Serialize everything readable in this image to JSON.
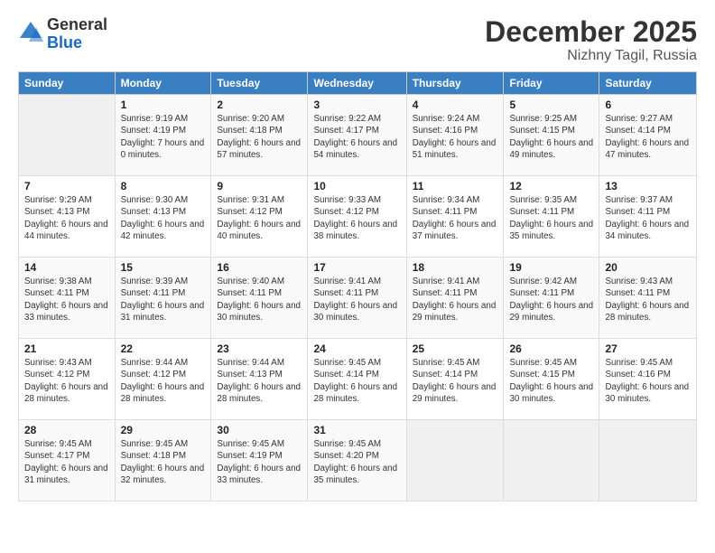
{
  "logo": {
    "general": "General",
    "blue": "Blue"
  },
  "title": {
    "month": "December 2025",
    "location": "Nizhny Tagil, Russia"
  },
  "days_of_week": [
    "Sunday",
    "Monday",
    "Tuesday",
    "Wednesday",
    "Thursday",
    "Friday",
    "Saturday"
  ],
  "weeks": [
    [
      {
        "day": "",
        "info": ""
      },
      {
        "day": "1",
        "info": "Sunrise: 9:19 AM\nSunset: 4:19 PM\nDaylight: 7 hours\nand 0 minutes."
      },
      {
        "day": "2",
        "info": "Sunrise: 9:20 AM\nSunset: 4:18 PM\nDaylight: 6 hours\nand 57 minutes."
      },
      {
        "day": "3",
        "info": "Sunrise: 9:22 AM\nSunset: 4:17 PM\nDaylight: 6 hours\nand 54 minutes."
      },
      {
        "day": "4",
        "info": "Sunrise: 9:24 AM\nSunset: 4:16 PM\nDaylight: 6 hours\nand 51 minutes."
      },
      {
        "day": "5",
        "info": "Sunrise: 9:25 AM\nSunset: 4:15 PM\nDaylight: 6 hours\nand 49 minutes."
      },
      {
        "day": "6",
        "info": "Sunrise: 9:27 AM\nSunset: 4:14 PM\nDaylight: 6 hours\nand 47 minutes."
      }
    ],
    [
      {
        "day": "7",
        "info": "Sunrise: 9:29 AM\nSunset: 4:13 PM\nDaylight: 6 hours\nand 44 minutes."
      },
      {
        "day": "8",
        "info": "Sunrise: 9:30 AM\nSunset: 4:13 PM\nDaylight: 6 hours\nand 42 minutes."
      },
      {
        "day": "9",
        "info": "Sunrise: 9:31 AM\nSunset: 4:12 PM\nDaylight: 6 hours\nand 40 minutes."
      },
      {
        "day": "10",
        "info": "Sunrise: 9:33 AM\nSunset: 4:12 PM\nDaylight: 6 hours\nand 38 minutes."
      },
      {
        "day": "11",
        "info": "Sunrise: 9:34 AM\nSunset: 4:11 PM\nDaylight: 6 hours\nand 37 minutes."
      },
      {
        "day": "12",
        "info": "Sunrise: 9:35 AM\nSunset: 4:11 PM\nDaylight: 6 hours\nand 35 minutes."
      },
      {
        "day": "13",
        "info": "Sunrise: 9:37 AM\nSunset: 4:11 PM\nDaylight: 6 hours\nand 34 minutes."
      }
    ],
    [
      {
        "day": "14",
        "info": "Sunrise: 9:38 AM\nSunset: 4:11 PM\nDaylight: 6 hours\nand 33 minutes."
      },
      {
        "day": "15",
        "info": "Sunrise: 9:39 AM\nSunset: 4:11 PM\nDaylight: 6 hours\nand 31 minutes."
      },
      {
        "day": "16",
        "info": "Sunrise: 9:40 AM\nSunset: 4:11 PM\nDaylight: 6 hours\nand 30 minutes."
      },
      {
        "day": "17",
        "info": "Sunrise: 9:41 AM\nSunset: 4:11 PM\nDaylight: 6 hours\nand 30 minutes."
      },
      {
        "day": "18",
        "info": "Sunrise: 9:41 AM\nSunset: 4:11 PM\nDaylight: 6 hours\nand 29 minutes."
      },
      {
        "day": "19",
        "info": "Sunrise: 9:42 AM\nSunset: 4:11 PM\nDaylight: 6 hours\nand 29 minutes."
      },
      {
        "day": "20",
        "info": "Sunrise: 9:43 AM\nSunset: 4:11 PM\nDaylight: 6 hours\nand 28 minutes."
      }
    ],
    [
      {
        "day": "21",
        "info": "Sunrise: 9:43 AM\nSunset: 4:12 PM\nDaylight: 6 hours\nand 28 minutes."
      },
      {
        "day": "22",
        "info": "Sunrise: 9:44 AM\nSunset: 4:12 PM\nDaylight: 6 hours\nand 28 minutes."
      },
      {
        "day": "23",
        "info": "Sunrise: 9:44 AM\nSunset: 4:13 PM\nDaylight: 6 hours\nand 28 minutes."
      },
      {
        "day": "24",
        "info": "Sunrise: 9:45 AM\nSunset: 4:14 PM\nDaylight: 6 hours\nand 28 minutes."
      },
      {
        "day": "25",
        "info": "Sunrise: 9:45 AM\nSunset: 4:14 PM\nDaylight: 6 hours\nand 29 minutes."
      },
      {
        "day": "26",
        "info": "Sunrise: 9:45 AM\nSunset: 4:15 PM\nDaylight: 6 hours\nand 30 minutes."
      },
      {
        "day": "27",
        "info": "Sunrise: 9:45 AM\nSunset: 4:16 PM\nDaylight: 6 hours\nand 30 minutes."
      }
    ],
    [
      {
        "day": "28",
        "info": "Sunrise: 9:45 AM\nSunset: 4:17 PM\nDaylight: 6 hours\nand 31 minutes."
      },
      {
        "day": "29",
        "info": "Sunrise: 9:45 AM\nSunset: 4:18 PM\nDaylight: 6 hours\nand 32 minutes."
      },
      {
        "day": "30",
        "info": "Sunrise: 9:45 AM\nSunset: 4:19 PM\nDaylight: 6 hours\nand 33 minutes."
      },
      {
        "day": "31",
        "info": "Sunrise: 9:45 AM\nSunset: 4:20 PM\nDaylight: 6 hours\nand 35 minutes."
      },
      {
        "day": "",
        "info": ""
      },
      {
        "day": "",
        "info": ""
      },
      {
        "day": "",
        "info": ""
      }
    ]
  ]
}
